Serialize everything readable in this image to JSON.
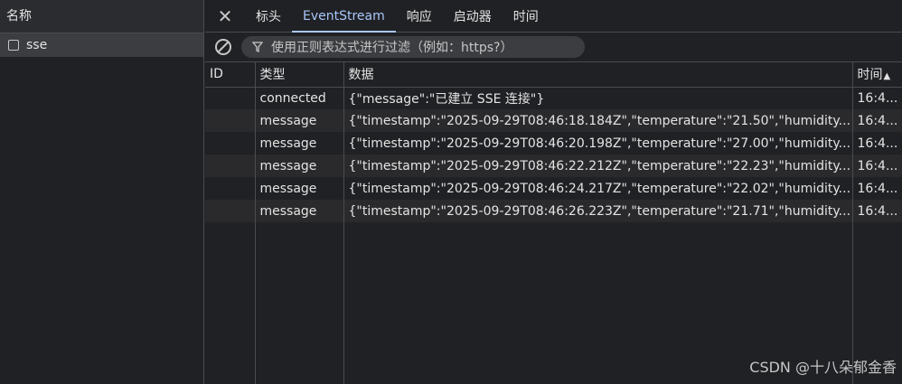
{
  "left_panel": {
    "header": "名称",
    "items": [
      {
        "label": "sse"
      }
    ]
  },
  "tabs": [
    {
      "label": "标头"
    },
    {
      "label": "EventStream",
      "active": true
    },
    {
      "label": "响应"
    },
    {
      "label": "启动器"
    },
    {
      "label": "时间"
    }
  ],
  "filter": {
    "placeholder": "使用正则表达式进行过滤（例如：https?）"
  },
  "table": {
    "columns": [
      "ID",
      "类型",
      "数据",
      "时间"
    ],
    "sort_indicator": "▲",
    "rows": [
      {
        "id": "",
        "type": "connected",
        "data": "{\"message\":\"已建立 SSE 连接\"}",
        "time": "16:4..."
      },
      {
        "id": "",
        "type": "message",
        "data": "{\"timestamp\":\"2025-09-29T08:46:18.184Z\",\"temperature\":\"21.50\",\"humidity...",
        "time": "16:4..."
      },
      {
        "id": "",
        "type": "message",
        "data": "{\"timestamp\":\"2025-09-29T08:46:20.198Z\",\"temperature\":\"27.00\",\"humidity...",
        "time": "16:4..."
      },
      {
        "id": "",
        "type": "message",
        "data": "{\"timestamp\":\"2025-09-29T08:46:22.212Z\",\"temperature\":\"22.23\",\"humidity...",
        "time": "16:4..."
      },
      {
        "id": "",
        "type": "message",
        "data": "{\"timestamp\":\"2025-09-29T08:46:24.217Z\",\"temperature\":\"22.02\",\"humidity...",
        "time": "16:4..."
      },
      {
        "id": "",
        "type": "message",
        "data": "{\"timestamp\":\"2025-09-29T08:46:26.223Z\",\"temperature\":\"21.71\",\"humidity...",
        "time": "16:4..."
      }
    ]
  },
  "watermark": "CSDN @十八朵郁金香",
  "colors": {
    "background": "#202124",
    "accent": "#a8c7fa",
    "selected_row": "#3c3d41"
  }
}
